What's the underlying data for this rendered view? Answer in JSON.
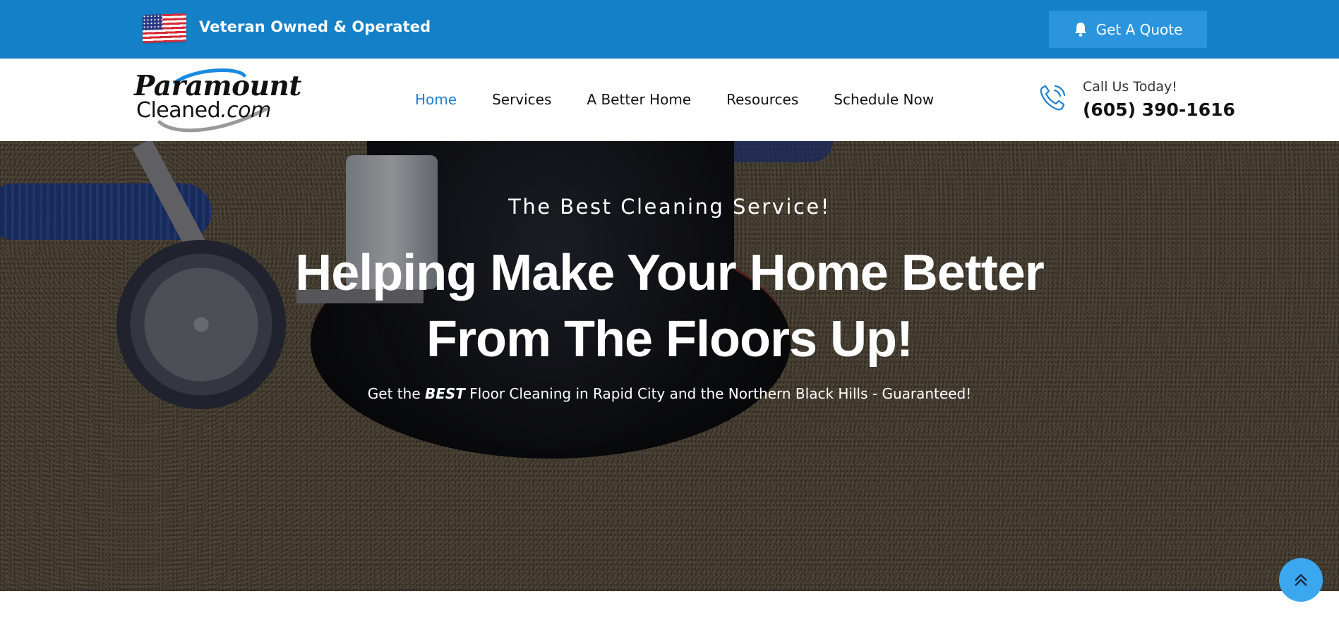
{
  "topbar": {
    "badge_text": "Veteran Owned & Operated",
    "quote_button": "Get A Quote",
    "quote_icon": "bell-icon",
    "flag_icon": "us-flag-icon"
  },
  "logo": {
    "line1": "Paramount",
    "line2_main": "Cleaned",
    "line2_suffix": ".com"
  },
  "nav": {
    "items": [
      {
        "label": "Home",
        "active": true
      },
      {
        "label": "Services",
        "active": false
      },
      {
        "label": "A Better Home",
        "active": false
      },
      {
        "label": "Resources",
        "active": false
      },
      {
        "label": "Schedule Now",
        "active": false
      }
    ]
  },
  "contact": {
    "label": "Call Us Today!",
    "phone": "(605) 390-1616",
    "icon": "phone-icon"
  },
  "hero": {
    "tagline": "The Best Cleaning Service!",
    "headline_line1": "Helping Make Your Home Better",
    "headline_line2": "From The Floors Up!",
    "subline_pre": "Get the ",
    "subline_emph": "BEST",
    "subline_post": " Floor Cleaning in Rapid City and the Northern Black Hills - Guaranteed!"
  },
  "scroll_top": {
    "icon": "double-chevron-up-icon"
  },
  "colors": {
    "topbar": "#1380c8",
    "button": "#2a95dc",
    "accent": "#1b80d6",
    "scroll_button": "#3ba7ef"
  }
}
